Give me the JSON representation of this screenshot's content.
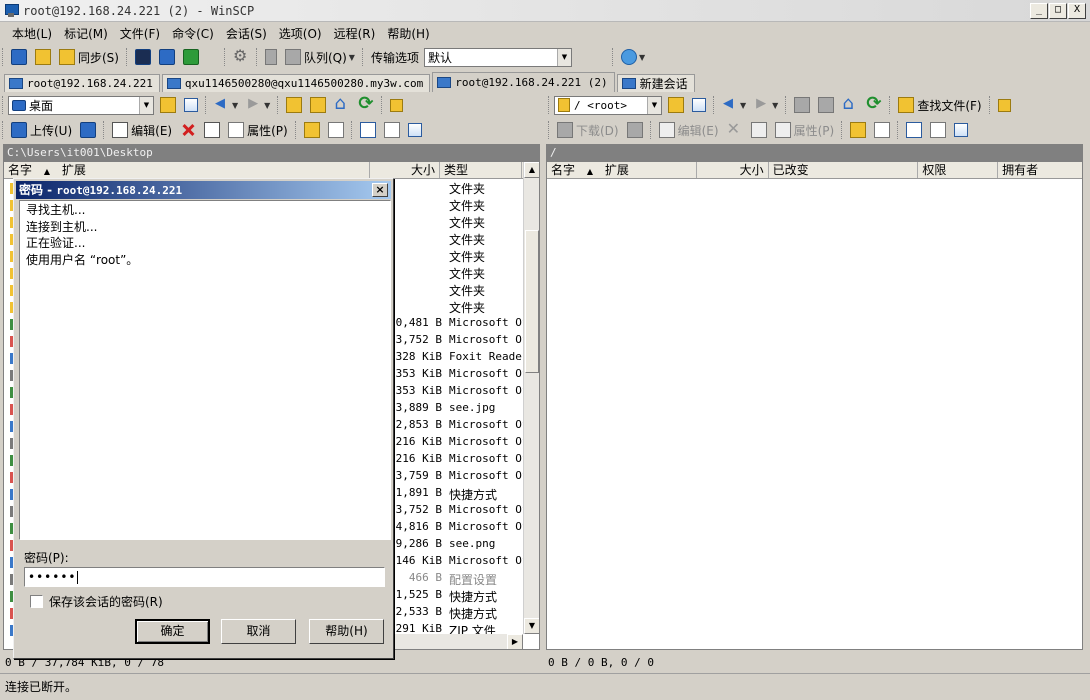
{
  "window": {
    "title": "root@192.168.24.221 (2) - WinSCP",
    "minimize": "_",
    "maximize": "□",
    "close": "X"
  },
  "menu": [
    "本地(L)",
    "标记(M)",
    "文件(F)",
    "命令(C)",
    "会话(S)",
    "选项(O)",
    "远程(R)",
    "帮助(H)"
  ],
  "toolbar": {
    "sync": "同步(S)",
    "queue": "队列(Q)",
    "transfer_options_label": "传输选项",
    "transfer_options_value": "默认"
  },
  "tabs": [
    {
      "label": "root@192.168.24.221",
      "active": false
    },
    {
      "label": "qxu1146500280@qxu1146500280.my3w.com",
      "active": false
    },
    {
      "label": "root@192.168.24.221 (2)",
      "active": true
    },
    {
      "label": "新建会话",
      "active": false
    }
  ],
  "left_panel": {
    "location": "桌面",
    "upload": "上传(U)",
    "edit": "编辑(E)",
    "properties": "属性(P)",
    "path": "C:\\Users\\it001\\Desktop",
    "columns": {
      "name": "名字",
      "ext": "扩展",
      "size": "大小",
      "type": "类型"
    },
    "rows": [
      {
        "size": "",
        "type": "文件夹"
      },
      {
        "size": "",
        "type": "文件夹"
      },
      {
        "size": "",
        "type": "文件夹"
      },
      {
        "size": "",
        "type": "文件夹"
      },
      {
        "size": "",
        "type": "文件夹"
      },
      {
        "size": "",
        "type": "文件夹"
      },
      {
        "size": "",
        "type": "文件夹"
      },
      {
        "size": "",
        "type": "文件夹"
      },
      {
        "size": "0,481 B",
        "type": "Microsoft Off"
      },
      {
        "size": "3,752 B",
        "type": "Microsoft Off"
      },
      {
        "size": "328 KiB",
        "type": "Foxit Reader"
      },
      {
        "size": "353 KiB",
        "type": "Microsoft Off"
      },
      {
        "size": "353 KiB",
        "type": "Microsoft Off"
      },
      {
        "size": "3,889 B",
        "type": "see.jpg"
      },
      {
        "size": "2,853 B",
        "type": "Microsoft Off"
      },
      {
        "size": "216 KiB",
        "type": "Microsoft Off"
      },
      {
        "size": "216 KiB",
        "type": "Microsoft Off"
      },
      {
        "size": "3,759 B",
        "type": "Microsoft Off"
      },
      {
        "size": "1,891 B",
        "type": "快捷方式"
      },
      {
        "size": "3,752 B",
        "type": "Microsoft Off"
      },
      {
        "size": "4,816 B",
        "type": "Microsoft Off"
      },
      {
        "size": "9,286 B",
        "type": "see.png"
      },
      {
        "size": "146 KiB",
        "type": "Microsoft Off"
      },
      {
        "size": "466 B",
        "type": "配置设置",
        "dim": true
      },
      {
        "size": "1,525 B",
        "type": "快捷方式"
      },
      {
        "size": "2,533 B",
        "type": "快捷方式"
      },
      {
        "size": "291 KiB",
        "type": "ZIP 文件"
      }
    ],
    "status": "0 B / 37,784 KiB,  0 / 78"
  },
  "right_panel": {
    "location": "/ <root>",
    "find_files": "查找文件(F)",
    "download": "下载(D)",
    "edit": "编辑(E)",
    "properties": "属性(P)",
    "path": "/",
    "columns": {
      "name": "名字",
      "ext": "扩展",
      "size": "大小",
      "changed": "已改变",
      "rights": "权限",
      "owner": "拥有者"
    },
    "status": "0 B / 0 B,  0 / 0"
  },
  "status_bar": "连接已断开。",
  "dialog": {
    "title_prefix": "密码 - ",
    "title_host": "root@192.168.24.221",
    "close": "×",
    "log": [
      "寻找主机...",
      "连接到主机...",
      "正在验证...",
      "使用用户名 “root”。"
    ],
    "password_label": "密码(P):",
    "password_value": "••••••",
    "save_password": "保存该会话的密码(R)",
    "ok": "确定",
    "cancel": "取消",
    "help": "帮助(H)"
  },
  "colors": {
    "dialog_title_start": "#0a246a",
    "dialog_title_end": "#a6caf0",
    "path_bar": "#808080"
  }
}
